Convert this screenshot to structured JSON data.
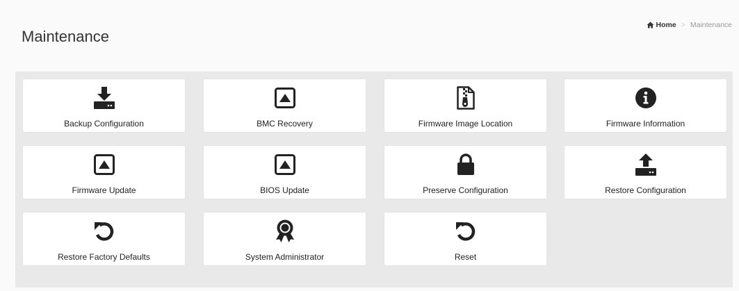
{
  "header": {
    "title": "Maintenance"
  },
  "breadcrumb": {
    "home_label": "Home",
    "separator": ">",
    "current": "Maintenance"
  },
  "tiles": [
    {
      "label": "Backup Configuration",
      "icon": "download-drive-icon"
    },
    {
      "label": "BMC Recovery",
      "icon": "upload-box-icon"
    },
    {
      "label": "Firmware Image Location",
      "icon": "zip-file-icon"
    },
    {
      "label": "Firmware Information",
      "icon": "info-circle-icon"
    },
    {
      "label": "Firmware Update",
      "icon": "upload-box-icon"
    },
    {
      "label": "BIOS Update",
      "icon": "upload-box-icon"
    },
    {
      "label": "Preserve Configuration",
      "icon": "lock-icon"
    },
    {
      "label": "Restore Configuration",
      "icon": "upload-drive-icon"
    },
    {
      "label": "Restore Factory Defaults",
      "icon": "undo-icon"
    },
    {
      "label": "System Administrator",
      "icon": "award-ribbon-icon"
    },
    {
      "label": "Reset",
      "icon": "undo-icon"
    }
  ],
  "colors": {
    "icon": "#222222",
    "panel_background": "#e9e9e9",
    "tile_background": "#ffffff"
  }
}
